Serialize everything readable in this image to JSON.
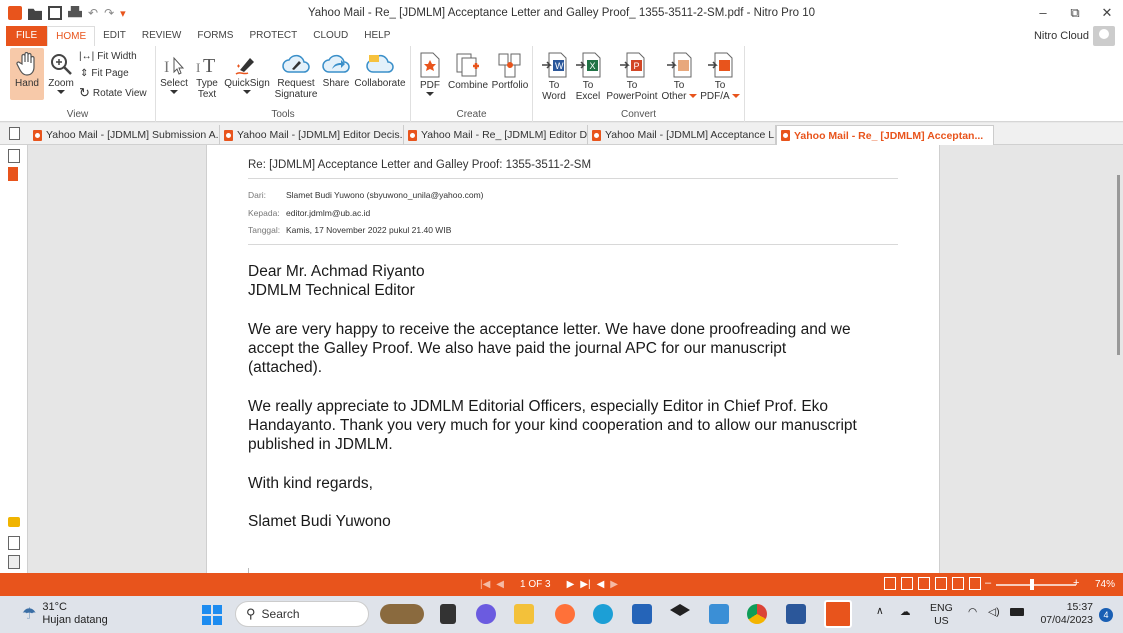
{
  "window": {
    "title": "Yahoo Mail - Re_ [JDMLM] Acceptance Letter and Galley Proof_ 1355-3511-2-SM.pdf - Nitro Pro 10",
    "controls": [
      "minimize",
      "restore",
      "close"
    ]
  },
  "menu": {
    "file": "FILE",
    "items": [
      "HOME",
      "EDIT",
      "REVIEW",
      "FORMS",
      "PROTECT",
      "CLOUD",
      "HELP"
    ],
    "active": "HOME",
    "account": "Nitro Cloud"
  },
  "ribbon": {
    "view": {
      "label": "View",
      "hand": "Hand",
      "zoom": "Zoom",
      "fit_width": "Fit Width",
      "fit_page": "Fit Page",
      "rotate_view": "Rotate View"
    },
    "tools": {
      "label": "Tools",
      "select": "Select",
      "type_text_1": "Type",
      "type_text_2": "Text",
      "quicksign": "QuickSign",
      "request_1": "Request",
      "request_2": "Signature",
      "share": "Share",
      "collaborate": "Collaborate"
    },
    "create": {
      "label": "Create",
      "pdf": "PDF",
      "combine": "Combine",
      "portfolio": "Portfolio"
    },
    "convert": {
      "label": "Convert",
      "to_word_1": "To",
      "to_word_2": "Word",
      "to_excel_1": "To",
      "to_excel_2": "Excel",
      "to_ppt_1": "To",
      "to_ppt_2": "PowerPoint",
      "to_other_1": "To",
      "to_other_2": "Other",
      "to_pdfa_1": "To",
      "to_pdfa_2": "PDF/A"
    }
  },
  "tabs": [
    {
      "label": "Yahoo Mail - [JDMLM] Submission A...",
      "active": false
    },
    {
      "label": "Yahoo Mail - [JDMLM] Editor Decis...",
      "active": false
    },
    {
      "label": "Yahoo Mail - Re_ [JDMLM] Editor D...",
      "active": false
    },
    {
      "label": "Yahoo Mail - [JDMLM] Acceptance L...",
      "active": false
    },
    {
      "label": "Yahoo Mail - Re_ [JDMLM] Acceptan...",
      "active": true
    }
  ],
  "email": {
    "subject": "Re: [JDMLM] Acceptance Letter and Galley Proof: 1355-3511-2-SM",
    "from_label": "Dari:",
    "from": "Slamet Budi Yuwono (sbyuwono_unila@yahoo.com)",
    "to_label": "Kepada:",
    "to": "editor.jdmlm@ub.ac.id",
    "date_label": "Tanggal:",
    "date": "Kamis, 17 November 2022 pukul 21.40 WIB",
    "greeting_1": "Dear Mr. Achmad Riyanto",
    "greeting_2": "JDMLM Technical Editor",
    "para1_l1": "We are very happy to receive the acceptance letter. We have done proofreading and we",
    "para1_l2": "accept the Galley Proof. We also have paid the journal APC for our manuscript",
    "para1_l3": "(attached).",
    "para2_l1": "We really appreciate to JDMLM Editorial Officers, especially Editor in Chief Prof. Eko",
    "para2_l2": "Handayanto. Thank you very much for your kind cooperation and to allow our manuscript",
    "para2_l3": "published in JDMLM.",
    "closing": "With kind regards,",
    "signature": "Slamet Budi Yuwono"
  },
  "status": {
    "page_indicator": "1 OF 3",
    "zoom": "74%",
    "zoom_fraction": 0.45
  },
  "taskbar": {
    "temperature": "31°C",
    "weather": "Hujan datang",
    "search_placeholder": "Search",
    "lang_1": "ENG",
    "lang_2": "US",
    "time": "15:37",
    "date": "07/04/2023",
    "notifications": "4"
  }
}
